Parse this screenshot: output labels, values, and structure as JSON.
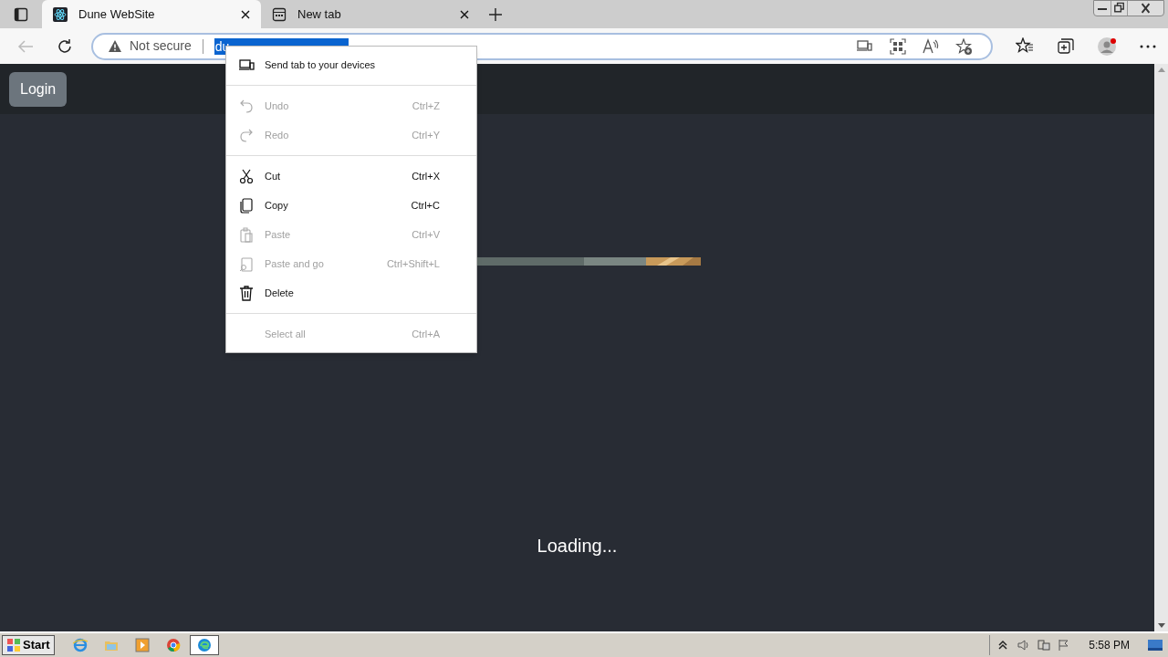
{
  "tabs": [
    {
      "label": "Dune WebSite",
      "selected": true
    },
    {
      "label": "New tab",
      "selected": false
    }
  ],
  "address_bar": {
    "security": "Not secure",
    "url": "du"
  },
  "page": {
    "login_button": "Login",
    "loading": "Loading..."
  },
  "context_menu": [
    {
      "kind": "item",
      "label": "Send tab to your devices",
      "disabled": false
    },
    {
      "kind": "separator"
    },
    {
      "kind": "item",
      "label": "Undo",
      "shortcut": "Ctrl+Z",
      "disabled": true
    },
    {
      "kind": "item",
      "label": "Redo",
      "shortcut": "Ctrl+Y",
      "disabled": true
    },
    {
      "kind": "separator"
    },
    {
      "kind": "item",
      "label": "Cut",
      "shortcut": "Ctrl+X",
      "disabled": false
    },
    {
      "kind": "item",
      "label": "Copy",
      "shortcut": "Ctrl+C",
      "disabled": false
    },
    {
      "kind": "item",
      "label": "Paste",
      "shortcut": "Ctrl+V",
      "disabled": true
    },
    {
      "kind": "item",
      "label": "Paste and go",
      "shortcut": "Ctrl+Shift+L",
      "disabled": true
    },
    {
      "kind": "item",
      "label": "Delete",
      "disabled": false
    },
    {
      "kind": "separator"
    },
    {
      "kind": "item",
      "label": "Select all",
      "shortcut": "Ctrl+A",
      "disabled": true
    }
  ],
  "taskbar": {
    "start": "Start",
    "apps": [
      {
        "selected": false
      },
      {
        "selected": false
      },
      {
        "selected": false
      },
      {
        "selected": false
      },
      {
        "selected": true
      }
    ],
    "clock": "5:58 PM"
  }
}
